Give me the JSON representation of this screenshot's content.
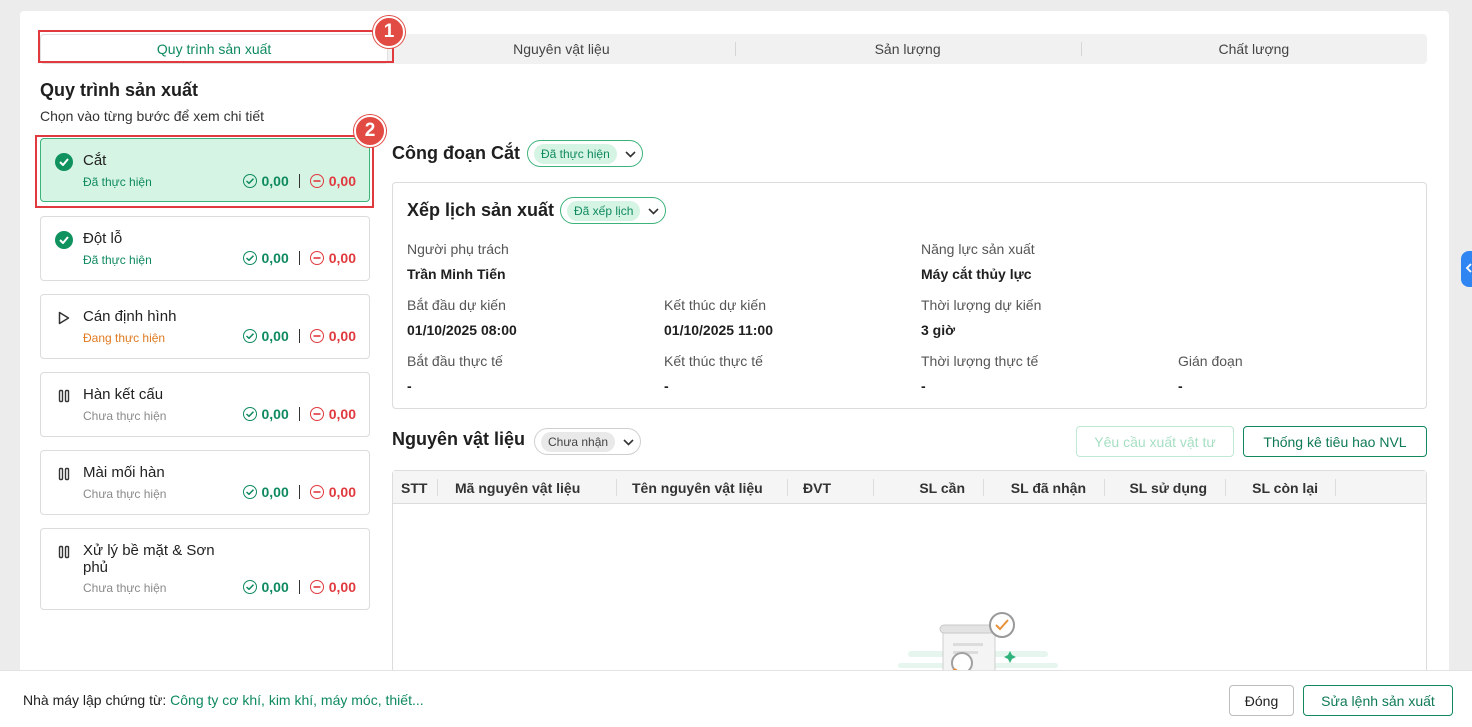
{
  "tabs": [
    {
      "label": "Quy trình sản xuất"
    },
    {
      "label": "Nguyên vật liệu"
    },
    {
      "label": "Sản lượng"
    },
    {
      "label": "Chất lượng"
    }
  ],
  "callouts": [
    "1",
    "2"
  ],
  "process": {
    "title": "Quy trình sản xuất",
    "subtitle": "Chọn vào từng bước để xem chi tiết",
    "steps": [
      {
        "name": "Cắt",
        "status": "Đã thực hiện",
        "ok": "0,00",
        "bad": "0,00"
      },
      {
        "name": "Đột lỗ",
        "status": "Đã thực hiện",
        "ok": "0,00",
        "bad": "0,00"
      },
      {
        "name": "Cán định hình",
        "status": "Đang thực hiện",
        "ok": "0,00",
        "bad": "0,00"
      },
      {
        "name": "Hàn kết cấu",
        "status": "Chưa thực hiện",
        "ok": "0,00",
        "bad": "0,00"
      },
      {
        "name": "Mài mối hàn",
        "status": "Chưa thực hiện",
        "ok": "0,00",
        "bad": "0,00"
      },
      {
        "name": "Xử lý bề mặt & Sơn phủ",
        "status": "Chưa thực hiện",
        "ok": "0,00",
        "bad": "0,00"
      }
    ]
  },
  "stage": {
    "title": "Công đoạn Cắt",
    "status": "Đã thực hiện"
  },
  "schedule": {
    "title": "Xếp lịch sản xuất",
    "status": "Đã xếp lịch",
    "owner_label": "Người phụ trách",
    "owner_value": "Trần Minh Tiến",
    "capacity_label": "Năng lực sản xuất",
    "capacity_value": "Máy cắt thủy lực",
    "plan_start_label": "Bắt đầu dự kiến",
    "plan_start_value": "01/10/2025 08:00",
    "plan_end_label": "Kết thúc dự kiến",
    "plan_end_value": "01/10/2025 11:00",
    "plan_duration_label": "Thời lượng dự kiến",
    "plan_duration_value": "3 giờ",
    "actual_start_label": "Bắt đầu thực tế",
    "actual_start_value": "-",
    "actual_end_label": "Kết thúc thực tế",
    "actual_end_value": "-",
    "actual_duration_label": "Thời lượng thực tế",
    "actual_duration_value": "-",
    "interrupt_label": "Gián đoạn",
    "interrupt_value": "-"
  },
  "materials": {
    "title": "Nguyên vật liệu",
    "status": "Chưa nhận",
    "request_button": "Yêu cầu xuất vật tư",
    "stats_button": "Thống kê tiêu hao NVL",
    "columns": [
      "STT",
      "Mã nguyên vật liệu",
      "Tên nguyên vật liệu",
      "ĐVT",
      "SL cần",
      "SL đã nhận",
      "SL sử dụng",
      "SL còn lại"
    ]
  },
  "footer": {
    "label": "Nhà máy lập chứng từ:",
    "value": "Công ty cơ khí, kim khí, máy móc, thiết...",
    "close_button": "Đóng",
    "edit_button": "Sửa lệnh sản xuất"
  },
  "colors": {
    "accent": "#0f8a5f",
    "active_bg": "#d6f4e4",
    "danger": "#e0393e",
    "in_progress": "#e07a1f",
    "callout": "#e24b44"
  }
}
